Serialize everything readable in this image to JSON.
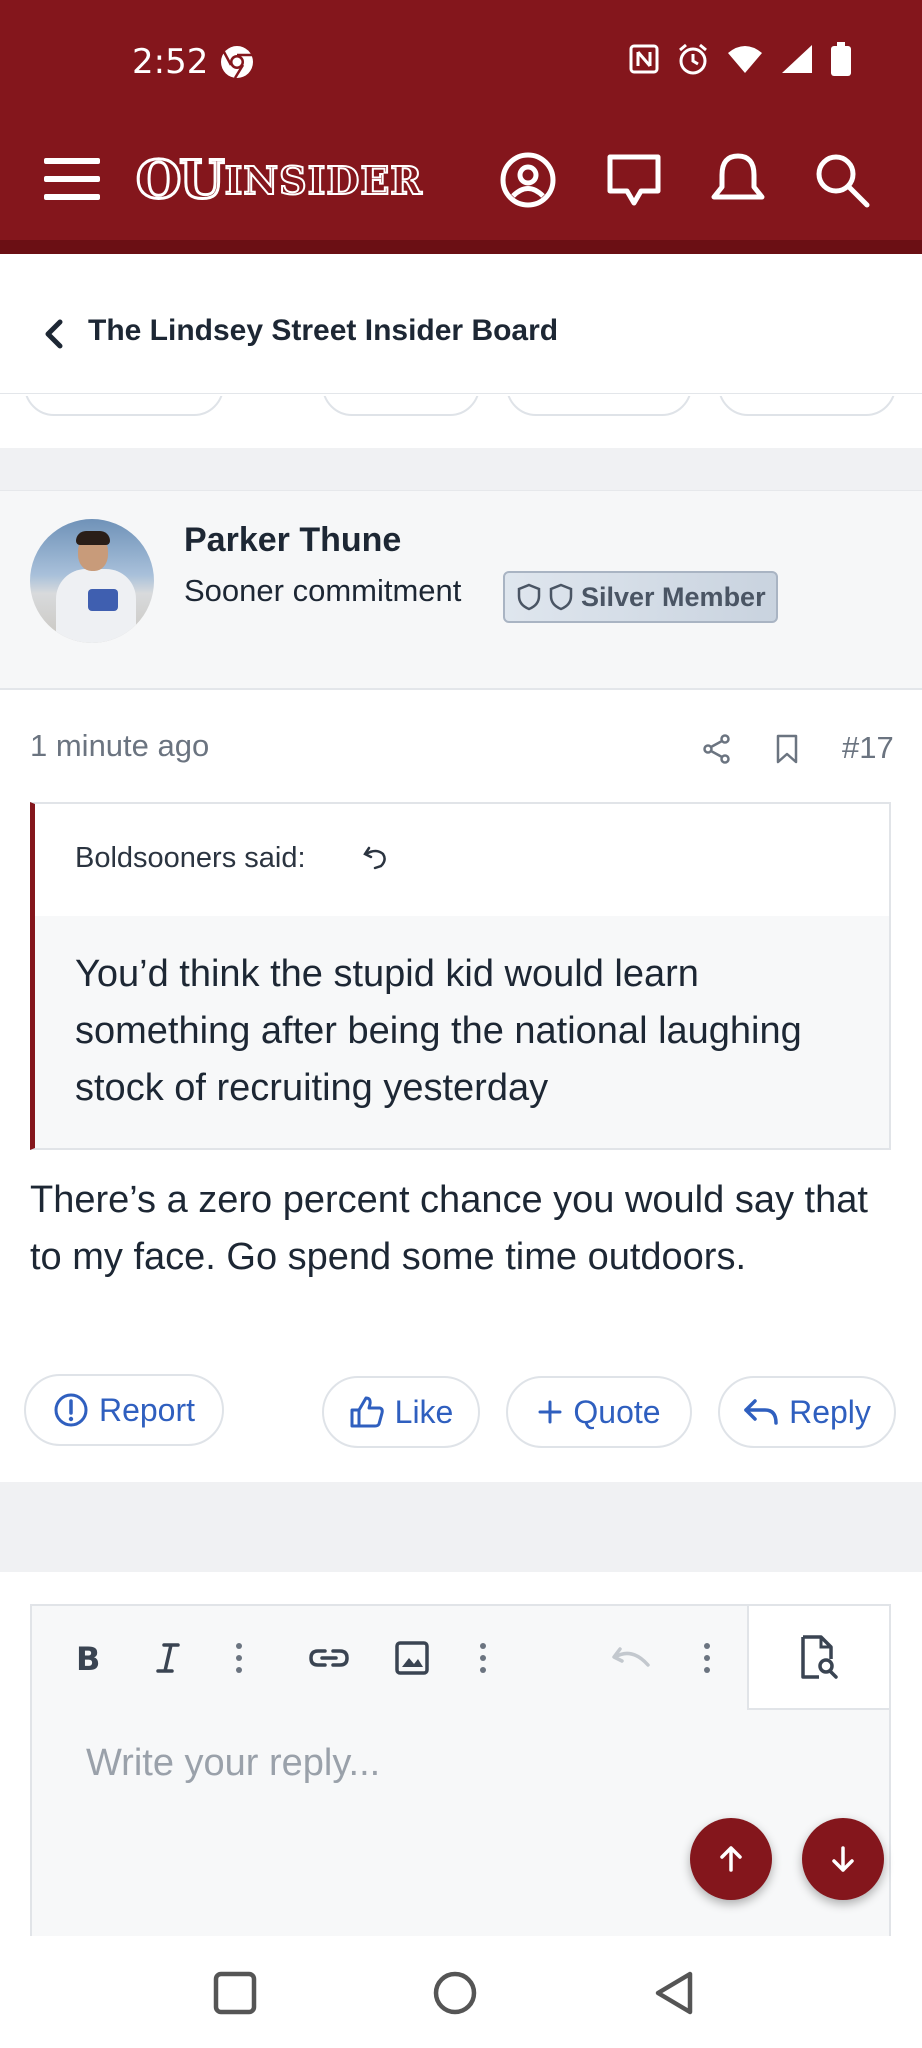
{
  "status_bar": {
    "time": "2:52"
  },
  "app": {
    "logo_ou": "OU",
    "logo_insider": "INSIDER"
  },
  "breadcrumb": {
    "label": "The Lindsey Street Insider Board"
  },
  "post": {
    "author": "Parker Thune",
    "user_title": "Sooner commitment",
    "badge": "Silver Member",
    "time": "1 minute ago",
    "number": "#17",
    "quote": {
      "author": "Boldsooners said:",
      "text": "You’d think the stupid kid would learn something after being the national laughing stock of recruiting yesterday"
    },
    "message": "There’s a zero percent chance you would say that to my face. Go spend some time outdoors.",
    "actions": {
      "report": "Report",
      "like": "Like",
      "quote": "Quote",
      "reply": "Reply"
    }
  },
  "editor": {
    "placeholder": "Write your reply..."
  },
  "colors": {
    "brand": "#84161c",
    "link": "#2f5fbf"
  },
  "icons": [
    "hamburger-icon",
    "account-icon",
    "messages-icon",
    "alerts-icon",
    "search-icon",
    "chevron-left-icon",
    "share-icon",
    "bookmark-icon",
    "bold-icon",
    "italic-icon",
    "link-icon",
    "image-icon",
    "undo-icon",
    "preview-icon",
    "arrow-up-icon",
    "arrow-down-icon"
  ]
}
